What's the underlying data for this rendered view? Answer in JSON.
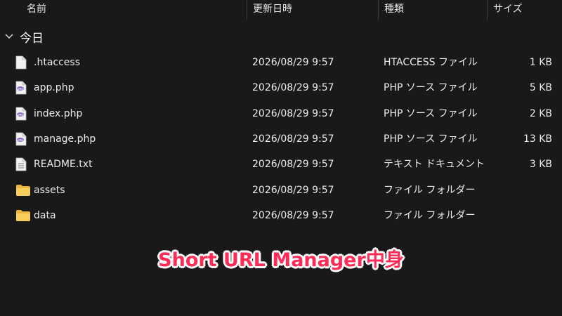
{
  "header": {
    "name": "名前",
    "modified": "更新日時",
    "type": "種類",
    "size": "サイズ"
  },
  "group": {
    "label": "今日"
  },
  "files": [
    {
      "name": ".htaccess",
      "modified": "2026/08/29 9:57",
      "type": "HTACCESS ファイル",
      "size": "1 KB",
      "icon": "text-file-icon"
    },
    {
      "name": "app.php",
      "modified": "2026/08/29 9:57",
      "type": "PHP ソース ファイル",
      "size": "5 KB",
      "icon": "php-file-icon"
    },
    {
      "name": "index.php",
      "modified": "2026/08/29 9:57",
      "type": "PHP ソース ファイル",
      "size": "2 KB",
      "icon": "php-file-icon"
    },
    {
      "name": "manage.php",
      "modified": "2026/08/29 9:57",
      "type": "PHP ソース ファイル",
      "size": "13 KB",
      "icon": "php-file-icon"
    },
    {
      "name": "README.txt",
      "modified": "2026/08/29 9:57",
      "type": "テキスト ドキュメント",
      "size": "3 KB",
      "icon": "text-document-icon"
    },
    {
      "name": "assets",
      "modified": "2026/08/29 9:57",
      "type": "ファイル フォルダー",
      "size": "",
      "icon": "folder-icon"
    },
    {
      "name": "data",
      "modified": "2026/08/29 9:57",
      "type": "ファイル フォルダー",
      "size": "",
      "icon": "folder-icon"
    }
  ],
  "caption": "Short URL Manager中身",
  "colors": {
    "background": "#191919",
    "caption": "#ff2a55",
    "caption_outline": "#ffffff",
    "php_badge": "#8a6cc4",
    "folder": "#f4c542"
  }
}
